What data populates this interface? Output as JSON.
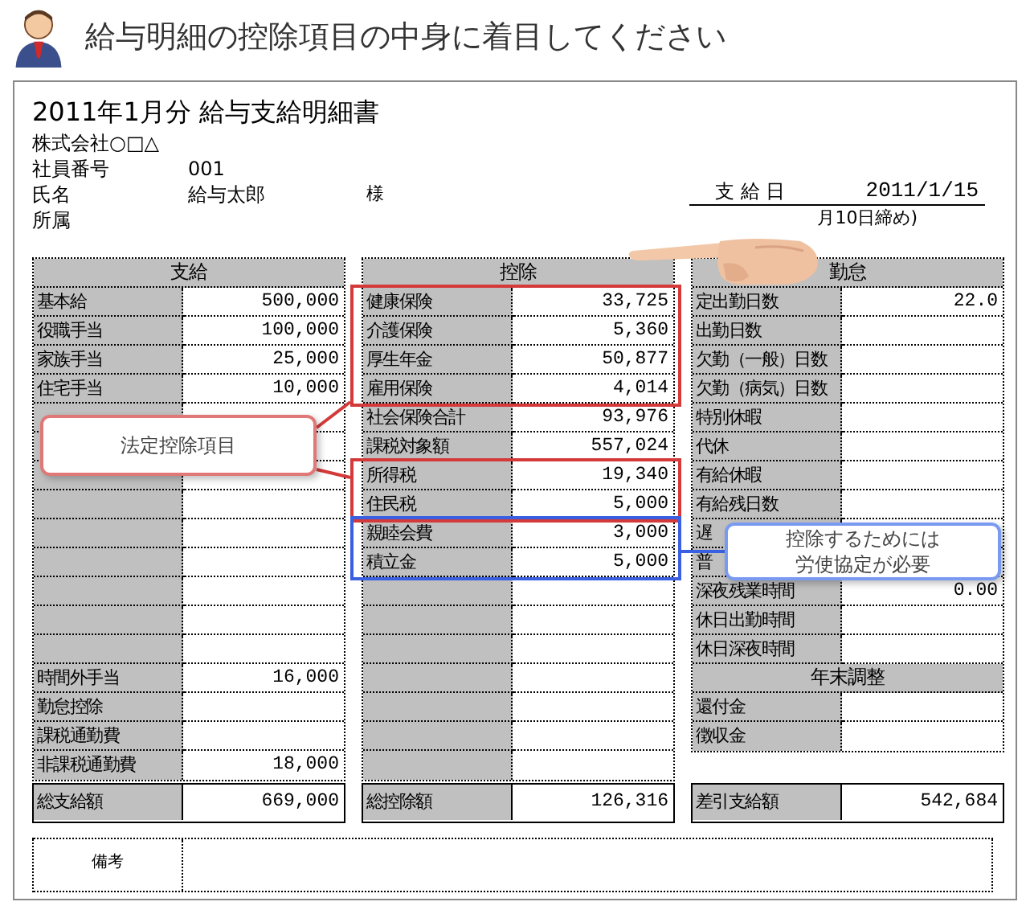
{
  "header": {
    "title": "給与明細の控除項目の中身に着目してください"
  },
  "slip": {
    "title": "2011年1月分 給与支給明細書",
    "company": "株式会社○□△",
    "info": [
      {
        "label": "社員番号",
        "value": "001"
      },
      {
        "label": "氏名",
        "value": "給与太郎",
        "suffix": "様"
      },
      {
        "label": "所属"
      }
    ],
    "pay_date": {
      "label": "支 給 日",
      "value": "2011/1/15",
      "note": "月10日締め)"
    }
  },
  "payments": {
    "heading": "支給",
    "rows": [
      {
        "label": "基本給",
        "value": "500,000"
      },
      {
        "label": "役職手当",
        "value": "100,000"
      },
      {
        "label": "家族手当",
        "value": "25,000"
      },
      {
        "label": "住宅手当",
        "value": "10,000"
      },
      {},
      {},
      {},
      {},
      {},
      {},
      {},
      {},
      {},
      {
        "label": "時間外手当",
        "value": "16,000"
      },
      {
        "label": "勤怠控除"
      },
      {
        "label": "課税通勤費"
      },
      {
        "label": "非課税通勤費",
        "value": "18,000"
      }
    ],
    "total": {
      "label": "総支給額",
      "value": "669,000"
    }
  },
  "deductions": {
    "heading": "控除",
    "rows": [
      {
        "label": "健康保険",
        "value": "33,725",
        "kind": "statutory"
      },
      {
        "label": "介護保険",
        "value": "5,360",
        "kind": "statutory"
      },
      {
        "label": "厚生年金",
        "value": "50,877",
        "kind": "statutory"
      },
      {
        "label": "雇用保険",
        "value": "4,014",
        "kind": "statutory"
      },
      {
        "label": "社会保険合計",
        "value": "93,976",
        "kind": "plain"
      },
      {
        "label": "課税対象額",
        "value": "557,024",
        "kind": "plain"
      },
      {
        "label": "所得税",
        "value": "19,340",
        "kind": "statutory"
      },
      {
        "label": "住民税",
        "value": "5,000",
        "kind": "statutory"
      },
      {
        "label": "親睦会費",
        "value": "3,000",
        "kind": "agreement"
      },
      {
        "label": "積立金",
        "value": "5,000",
        "kind": "agreement"
      },
      {
        "kind": "plain"
      },
      {
        "kind": "plain"
      },
      {
        "kind": "plain"
      },
      {
        "kind": "plain"
      },
      {
        "kind": "plain"
      },
      {
        "kind": "plain"
      },
      {
        "kind": "plain"
      }
    ],
    "total": {
      "label": "総控除額",
      "value": "126,316"
    }
  },
  "attendance": {
    "heading": "勤怠",
    "rows": [
      {
        "label": "定出勤日数",
        "value": "22.0"
      },
      {
        "label": "出勤日数"
      },
      {
        "label": "欠勤（一般）日数"
      },
      {
        "label": "欠勤（病気）日数"
      },
      {
        "label": "特別休暇"
      },
      {
        "label": "代休"
      },
      {
        "label": "有給休暇"
      },
      {
        "label": "有給残日数"
      },
      {
        "label": "遅"
      },
      {
        "label": "普"
      },
      {
        "label": "深夜残業時間",
        "value": "0.00"
      },
      {
        "label": "休日出勤時間"
      },
      {
        "label": "休日深夜時間"
      }
    ],
    "subheading": "年末調整",
    "sub_rows": [
      {
        "label": "還付金"
      },
      {
        "label": "徴収金"
      }
    ],
    "total": {
      "label": "差引支給額",
      "value": "542,684"
    }
  },
  "remarks": {
    "label": "備考"
  },
  "callouts": [
    {
      "lines": [
        "法定控除項目"
      ],
      "kind": "statutory"
    },
    {
      "lines": [
        "控除するためには",
        "労使協定が必要"
      ],
      "kind": "agreement"
    }
  ]
}
